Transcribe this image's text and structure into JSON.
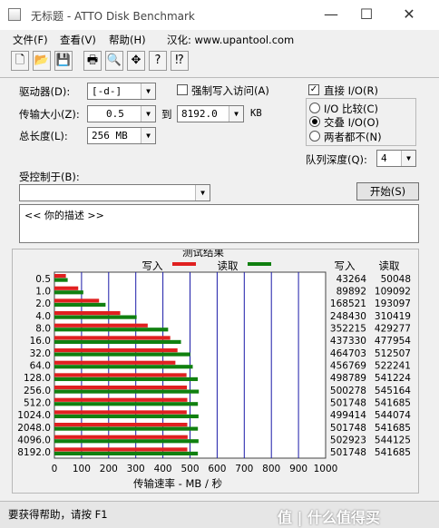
{
  "window": {
    "title": "无标题 - ATTO Disk Benchmark",
    "minimize_glyph": "—",
    "maximize_glyph": "☐",
    "close_glyph": "✕"
  },
  "menu": [
    {
      "label": "文件(F)"
    },
    {
      "label": "查看(V)"
    },
    {
      "label": "帮助(H)"
    },
    {
      "label": "汉化: www.upantool.com"
    }
  ],
  "toolbar": [
    {
      "icon": "new-file-icon",
      "glyph": "🗋"
    },
    {
      "icon": "open-folder-icon",
      "glyph": "📂"
    },
    {
      "icon": "save-disk-icon",
      "glyph": "💾"
    },
    {
      "icon": "print-icon",
      "glyph": "🖶"
    },
    {
      "icon": "print-preview-icon",
      "glyph": "🔍"
    },
    {
      "icon": "move-icon",
      "glyph": "✥"
    },
    {
      "icon": "help-icon",
      "glyph": "?"
    },
    {
      "icon": "context-help-icon",
      "glyph": "⁉"
    }
  ],
  "settings": {
    "drive_label": "驱动器(D):",
    "drive_value": "[-d-]",
    "transfer_size_label": "传输大小(Z):",
    "transfer_min": "0.5",
    "to_label": "到",
    "transfer_max": "8192.0",
    "kb_label": "KB",
    "total_length_label": "总长度(L):",
    "total_length_value": "256 MB",
    "force_write_label": "强制写入访问(A)",
    "force_write_checked": false,
    "direct_io_label": "直接 I/O(R)",
    "direct_io_checked": true,
    "io_compare_label": "I/O 比较(C)",
    "overlapped_io_label": "交叠 I/O(O)",
    "neither_label": "两者都不(N)",
    "selected_mode": "overlapped",
    "queue_depth_label": "队列深度(Q):",
    "queue_depth_value": "4",
    "controlled_by_label": "受控制于(B):",
    "controlled_by_value": "",
    "start_button": "开始(S)",
    "description": "<<   你的描述    >>",
    "check_glyph": "✓",
    "dropdown_glyph": "▼"
  },
  "results": {
    "title": "测试结果",
    "write_legend": "写入",
    "read_legend": "读取",
    "col_write": "写入",
    "col_read": "读取",
    "xlabel": "传输速率 - MB / 秒"
  },
  "chart_data": {
    "type": "bar",
    "orientation": "horizontal",
    "title": "测试结果",
    "xlabel": "传输速率 - MB / 秒",
    "xlim": [
      0,
      1000
    ],
    "xticks": [
      0,
      100,
      200,
      300,
      400,
      500,
      600,
      700,
      800,
      900,
      1000
    ],
    "categories": [
      "0.5",
      "1.0",
      "2.0",
      "4.0",
      "8.0",
      "16.0",
      "32.0",
      "64.0",
      "128.0",
      "256.0",
      "512.0",
      "1024.0",
      "2048.0",
      "4096.0",
      "8192.0"
    ],
    "series": [
      {
        "name": "写入",
        "color": "#e02020",
        "values": [
          43264,
          89892,
          168521,
          248430,
          352215,
          437330,
          464703,
          456769,
          498789,
          500278,
          501748,
          499414,
          501748,
          502923,
          501748
        ]
      },
      {
        "name": "读取",
        "color": "#108010",
        "values": [
          50048,
          109092,
          193097,
          310419,
          429277,
          477954,
          512507,
          522241,
          541224,
          545164,
          541685,
          544074,
          541685,
          544125,
          541685
        ]
      }
    ],
    "value_units": "KB/s",
    "grid": true,
    "legend_position": "top"
  },
  "status": {
    "text": "要获得帮助，请按 F1"
  },
  "watermark": {
    "text": "值 | 什么值得买"
  }
}
